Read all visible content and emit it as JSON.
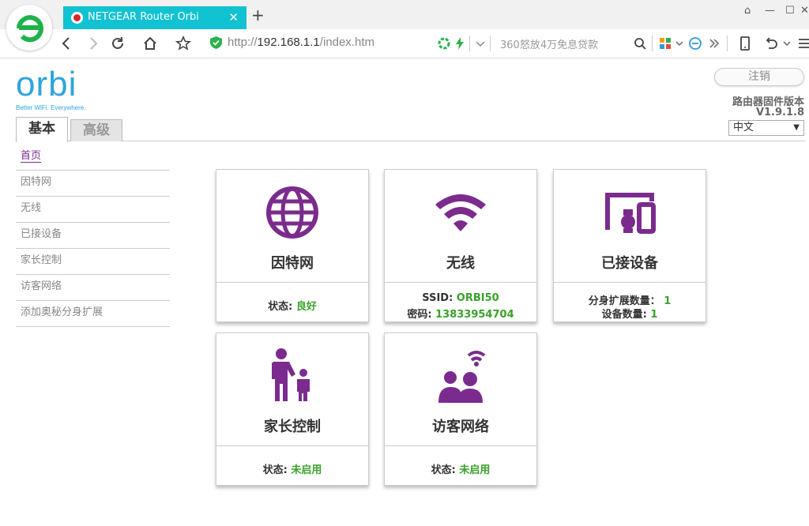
{
  "browser": {
    "tab_title": "NETGEAR Router Orbi",
    "tab_close": "✕",
    "new_tab": "+",
    "url_prefix": "http://",
    "url_host": "192.168.1.1",
    "url_path": "/index.htm",
    "search_placeholder": "360怒放4万免息贷款",
    "window_controls": [
      "⌂",
      "—",
      "☐",
      "✕"
    ]
  },
  "header": {
    "brand": "orbi",
    "tagline": "Better WiFi. Everywhere.",
    "logout_label": "注销",
    "firmware_label": "路由器固件版本",
    "firmware_version": "V1.9.1.8",
    "language": "中文"
  },
  "tabs": [
    {
      "label": "基本",
      "active": true
    },
    {
      "label": "高级",
      "active": false
    }
  ],
  "sidebar": {
    "items": [
      {
        "label": "首页"
      },
      {
        "label": "因特网"
      },
      {
        "label": "无线"
      },
      {
        "label": "已接设备"
      },
      {
        "label": "家长控制"
      },
      {
        "label": "访客网络"
      },
      {
        "label": "添加奥秘分身扩展"
      }
    ]
  },
  "cards": {
    "internet": {
      "title": "因特网",
      "status_label": "状态: ",
      "status_value": "良好"
    },
    "wireless": {
      "title": "无线",
      "ssid_label": "SSID: ",
      "ssid_value": "ORBI50",
      "pwd_label": "密码: ",
      "pwd_value": "13833954704"
    },
    "devices": {
      "title": "已接设备",
      "sat_label": "分身扩展数量： ",
      "sat_value": "1",
      "dev_label": "设备数量: ",
      "dev_value": "1"
    },
    "parental": {
      "title": "家长控制",
      "status_label": "状态: ",
      "status_value": "未启用"
    },
    "guest": {
      "title": "访客网络",
      "status_label": "状态: ",
      "status_value": "未启用"
    }
  },
  "colors": {
    "accent": "#7b2b8d",
    "ok": "#3aa12a",
    "brand": "#2ea4dd",
    "tab": "#11c2d2"
  }
}
